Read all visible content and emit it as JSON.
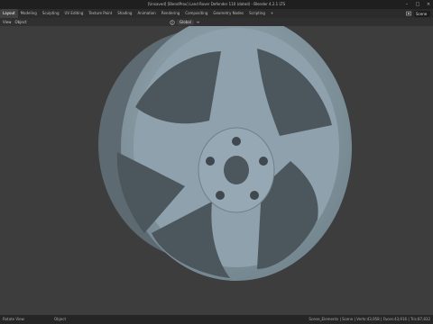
{
  "window": {
    "title": "[Unsaved] [BlendProx] Land Rover Defender 110 (dated) - Blender 4.2.1 LTS",
    "minimize_glyph": "–",
    "maximize_glyph": "□",
    "close_glyph": "×"
  },
  "workspace_tabs": [
    "Layout",
    "Modeling",
    "Sculpting",
    "UV Editing",
    "Texture Paint",
    "Shading",
    "Animation",
    "Rendering",
    "Compositing",
    "Geometry Nodes",
    "Scripting"
  ],
  "add_tab_glyph": "+",
  "scene_field": "Scene",
  "header": {
    "menus": [
      "View",
      "Object"
    ],
    "pivot_label": "Global"
  },
  "viewport": {
    "background_color": "#3d3d3d",
    "wheel_color": "#8a9ba6",
    "wheel_shadow_color": "#546069"
  },
  "status_bar": {
    "left_hint": "Rotate View",
    "mid_hint": "Object",
    "right_stats": "Scene_Elements | Scene | Verts:43,958 | Faces:43,916 | Tris:87,832"
  }
}
